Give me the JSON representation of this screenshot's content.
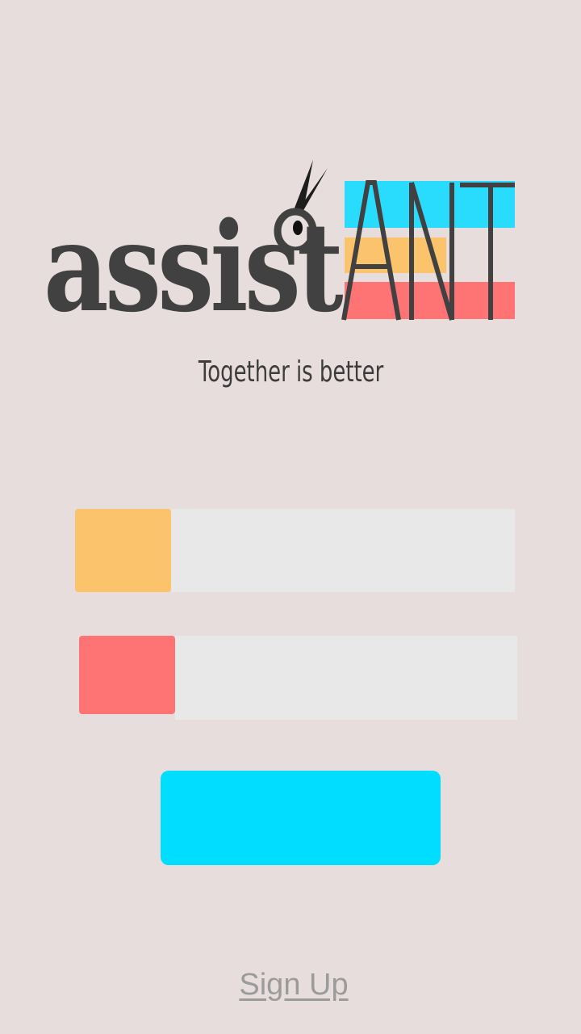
{
  "logo": {
    "word": "assist",
    "suffix": "ANT",
    "colors": {
      "text": "#414141",
      "blue": "#29dcfe",
      "yellow": "#fcc36d",
      "red": "#fe7373"
    }
  },
  "tagline": "Together is better",
  "form": {
    "email": {
      "swatch_color": "#fcc36d",
      "placeholder": "",
      "value": ""
    },
    "password": {
      "swatch_color": "#fe7373",
      "placeholder": "",
      "value": ""
    },
    "login_button": {
      "label": "",
      "color": "#00ddff"
    }
  },
  "signup": {
    "label": "Sign Up"
  }
}
